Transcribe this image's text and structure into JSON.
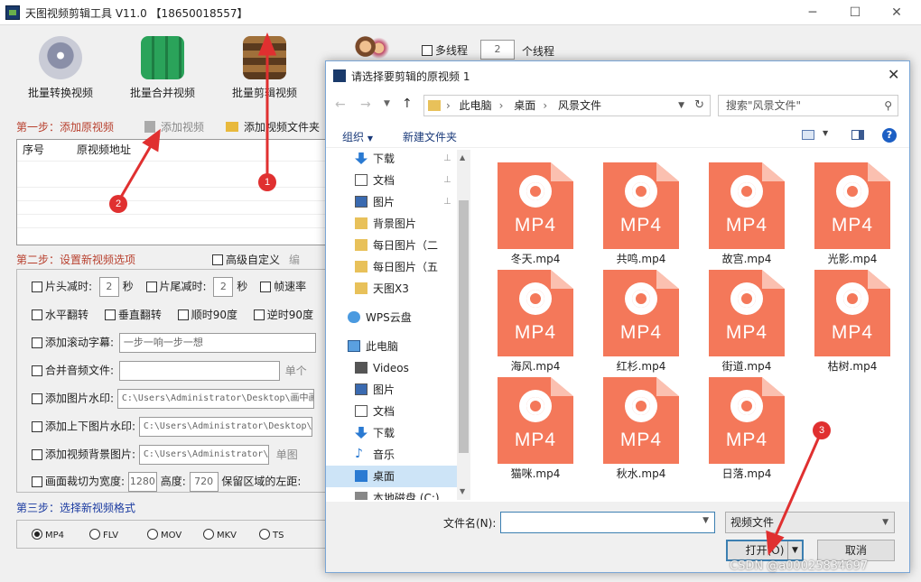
{
  "app": {
    "title": "天图视频剪辑工具 V11.0 【18650018557】"
  },
  "toolbar": {
    "items": [
      "批量转换视频",
      "批量合并视频",
      "批量剪辑视频"
    ],
    "multithread_label": "多线程",
    "thread_count": "2",
    "thread_unit": "个线程"
  },
  "step1": {
    "label": "第一步：添加原视频",
    "add_video": "添加视频",
    "add_folder": "添加视频文件夹"
  },
  "list": {
    "col_index": "序号",
    "col_path": "原视频地址"
  },
  "step2": {
    "label": "第二步：设置新视频选项",
    "advanced": "高级自定义",
    "advanced_tail": "编"
  },
  "options": {
    "head_cut": "片头减时:",
    "head_val": "2",
    "sec": "秒",
    "tail_cut": "片尾减时:",
    "tail_val": "2",
    "fps": "帧速率",
    "hflip": "水平翻转",
    "vflip": "垂直翻转",
    "rot90cw": "顺时90度",
    "rot90ccw": "逆时90度",
    "subtitle": "添加滚动字幕:",
    "subtitle_val": "一步一响一步一想",
    "audio": "合并音频文件:",
    "audio_tail": "单个",
    "img_wm": "添加图片水印:",
    "img_wm_val": "C:\\Users\\Administrator\\Desktop\\画中画",
    "tb_wm": "添加上下图片水印:",
    "tb_wm_val": "C:\\Users\\Administrator\\Desktop\\Q",
    "bg_img": "添加视频背景图片:",
    "bg_img_val": "C:\\Users\\Administrator\\D",
    "bg_tail": "单图",
    "crop": "画面裁切为宽度:",
    "crop_w": "1280",
    "crop_h_label": "高度:",
    "crop_h": "720",
    "keep": "保留区域的左距:"
  },
  "step3": {
    "label": "第三步：选择新视频格式",
    "formats": [
      "MP4",
      "FLV",
      "MOV",
      "MKV",
      "TS"
    ],
    "selected": "MP4"
  },
  "dialog": {
    "title": "请选择要剪辑的原视频 1",
    "breadcrumb": [
      "此电脑",
      "桌面",
      "风景文件"
    ],
    "search_placeholder": "搜索\"风景文件\"",
    "organize": "组织",
    "new_folder": "新建文件夹",
    "tree": [
      "下载",
      "文档",
      "图片",
      "背景图片",
      "每日图片（二",
      "每日图片（五",
      "天图X3",
      "WPS云盘",
      "此电脑",
      "Videos",
      "图片",
      "文档",
      "下载",
      "音乐",
      "桌面",
      "本地磁盘 (C:)"
    ],
    "files": [
      "冬天.mp4",
      "共鸣.mp4",
      "故宫.mp4",
      "光影.mp4",
      "海风.mp4",
      "红杉.mp4",
      "街道.mp4",
      "枯树.mp4",
      "猫咪.mp4",
      "秋水.mp4",
      "日落.mp4"
    ],
    "file_ext": "MP4",
    "filename_label": "文件名(N):",
    "filetype": "视频文件",
    "open": "打开(O)",
    "cancel": "取消"
  },
  "annotations": [
    "1",
    "2",
    "3"
  ],
  "watermark": "CSDN @a00025834697",
  "colors": {
    "step": "#b8402e",
    "step3": "#1a3aa0",
    "file_icon": "#f4785a",
    "badge": "#e03030"
  }
}
